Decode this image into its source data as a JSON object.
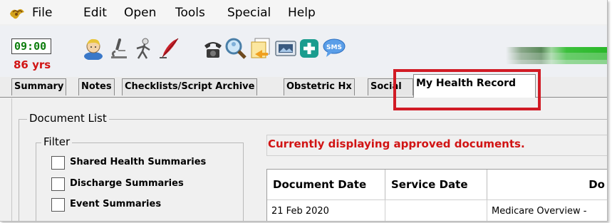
{
  "menu": {
    "items": [
      "File",
      "Edit",
      "Open",
      "Tools",
      "Special",
      "Help"
    ]
  },
  "toolbar": {
    "time": "09:00",
    "age": "86 yrs",
    "icons": [
      "patient-icon",
      "microscope-icon",
      "xray-icon",
      "quill-pen-icon",
      "telephone-icon",
      "search-icon",
      "documents-icon",
      "image-icon",
      "add-plus-icon",
      "sms-icon"
    ],
    "sms_text": "SMS"
  },
  "tabs": [
    {
      "label": "Summary"
    },
    {
      "label": "Notes"
    },
    {
      "label": "Checklists/Script Archive"
    },
    {
      "label": "Obstetric Hx"
    },
    {
      "label": "Social"
    },
    {
      "label": "My Health Record"
    }
  ],
  "content": {
    "document_list_label": "Document List",
    "filter_label": "Filter",
    "filters": [
      {
        "label": "Shared Health Summaries",
        "checked": false
      },
      {
        "label": "Discharge Summaries",
        "checked": false
      },
      {
        "label": "Event Summaries",
        "checked": false
      }
    ],
    "status_message": "Currently displaying approved documents.",
    "table": {
      "columns": [
        "Document Date",
        "Service Date",
        "Do"
      ],
      "rows": [
        [
          "21 Feb 2020",
          "",
          "Medicare Overview -"
        ]
      ]
    }
  },
  "colors": {
    "highlight": "#d11b25",
    "status_red": "#d11414",
    "time_green": "#0c7d0c"
  }
}
